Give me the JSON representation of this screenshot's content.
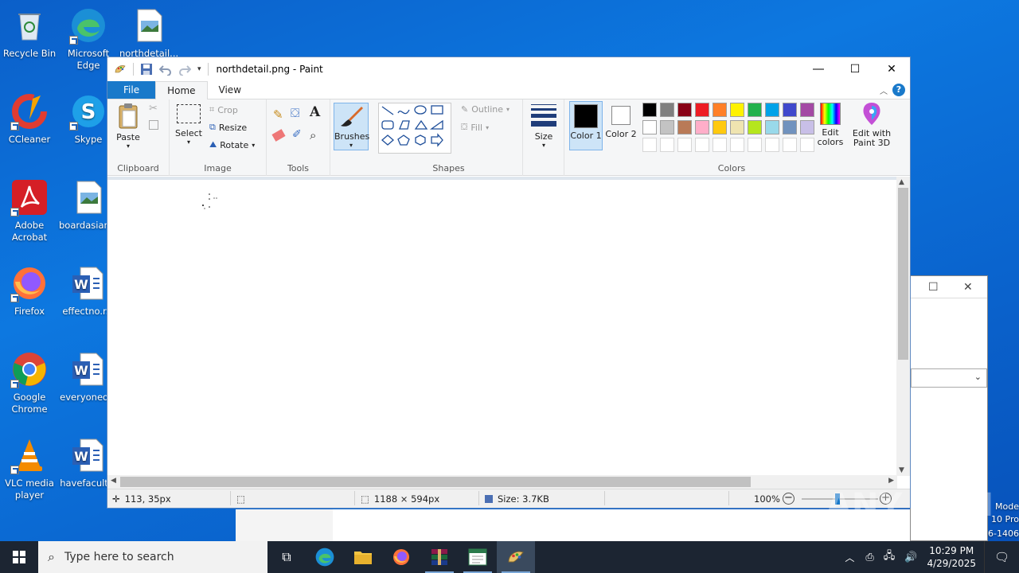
{
  "desktop": {
    "icons": [
      {
        "label": "Recycle Bin"
      },
      {
        "label": "Microsoft Edge"
      },
      {
        "label": "northdetail..."
      },
      {
        "label": "CCleaner"
      },
      {
        "label": "Skype"
      },
      {
        "label": "Adobe Acrobat"
      },
      {
        "label": "boardasian..."
      },
      {
        "label": "Firefox"
      },
      {
        "label": "effectno.r..."
      },
      {
        "label": "Google Chrome"
      },
      {
        "label": "everyoneo..."
      },
      {
        "label": "VLC media player"
      },
      {
        "label": "havefacult..."
      }
    ],
    "side_text": [
      "Mode",
      "10 Pro",
      "6-1406"
    ],
    "watermark": "ANY RUN"
  },
  "paint": {
    "title": "northdetail.png - Paint",
    "tabs": {
      "file": "File",
      "home": "Home",
      "view": "View"
    },
    "ribbon": {
      "clipboard": {
        "label": "Clipboard",
        "paste": "Paste"
      },
      "image": {
        "label": "Image",
        "select": "Select",
        "crop": "Crop",
        "resize": "Resize",
        "rotate": "Rotate"
      },
      "tools": {
        "label": "Tools"
      },
      "brushes": "Brushes",
      "shapes": {
        "label": "Shapes",
        "outline": "Outline",
        "fill": "Fill"
      },
      "size": "Size",
      "colors": {
        "label": "Colors",
        "color1": "Color 1",
        "color2": "Color 2",
        "edit_colors": "Edit colors",
        "edit_paint3d": "Edit with Paint 3D",
        "palette_row1": [
          "#000000",
          "#7f7f7f",
          "#880015",
          "#ed1c24",
          "#ff7f27",
          "#fff200",
          "#22b14c",
          "#00a2e8",
          "#3f48cc",
          "#a349a4"
        ],
        "palette_row2": [
          "#ffffff",
          "#c3c3c3",
          "#b97a57",
          "#ffaec9",
          "#ffc90e",
          "#efe4b0",
          "#b5e61d",
          "#99d9ea",
          "#7092be",
          "#c8bfe7"
        ]
      }
    },
    "status": {
      "cursor": "113, 35px",
      "image_size": "1188 × 594px",
      "file_size": "Size: 3.7KB",
      "zoom": "100%"
    }
  },
  "taskbar": {
    "search_placeholder": "Type here to search",
    "time": "10:29 PM",
    "date": "4/29/2025"
  }
}
